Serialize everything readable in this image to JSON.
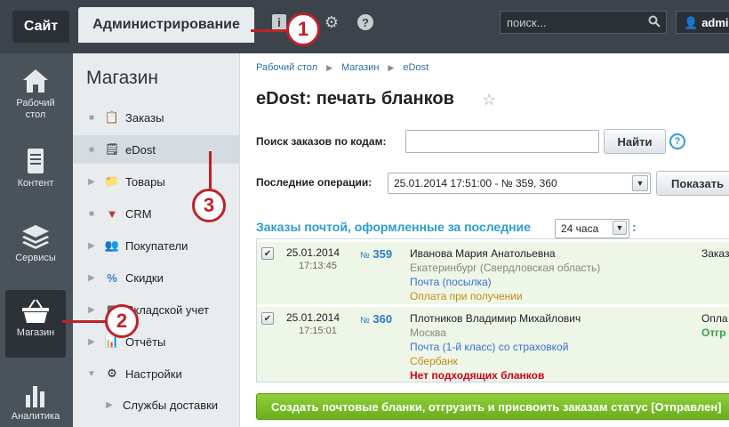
{
  "topbar": {
    "site_tab": "Сайт",
    "admin_tab": "Администрирование",
    "search_placeholder": "поиск...",
    "user": "admin"
  },
  "darkside": {
    "items": [
      {
        "label": "Рабочий стол",
        "icon": "home-icon"
      },
      {
        "label": "Контент",
        "icon": "document-icon"
      },
      {
        "label": "Сервисы",
        "icon": "layers-icon"
      },
      {
        "label": "Магазин",
        "icon": "basket-icon"
      },
      {
        "label": "Аналитика",
        "icon": "bar-chart-icon"
      }
    ]
  },
  "menu": {
    "title": "Магазин",
    "items": [
      {
        "label": "Заказы",
        "icon": "orders-icon",
        "mark": "bullet"
      },
      {
        "label": "eDost",
        "icon": "edost-icon",
        "mark": "bullet"
      },
      {
        "label": "Товары",
        "icon": "folder-icon",
        "mark": "arrow"
      },
      {
        "label": "CRM",
        "icon": "crm-icon",
        "mark": "bullet"
      },
      {
        "label": "Покупатели",
        "icon": "users-icon",
        "mark": "arrow"
      },
      {
        "label": "Скидки",
        "icon": "percent-icon",
        "mark": "arrow"
      },
      {
        "label": "Складской учет",
        "icon": "warehouse-icon",
        "mark": "arrow"
      },
      {
        "label": "Отчёты",
        "icon": "reports-icon",
        "mark": "arrow"
      },
      {
        "label": "Настройки",
        "icon": "settings-icon",
        "mark": "arrow-down"
      }
    ],
    "sub_item": "Службы доставки"
  },
  "breadcrumb": [
    "Рабочий стол",
    "Магазин",
    "eDost"
  ],
  "page_title": "eDost: печать бланков",
  "search": {
    "label": "Поиск заказов по кодам:",
    "value": "",
    "button": "Найти"
  },
  "last_ops": {
    "label": "Последние операции:",
    "selected": "25.01.2014 17:51:00 - № 359, 360",
    "button": "Показать"
  },
  "section": {
    "title": "Заказы почтой, оформленные за последние",
    "period": "24 часа",
    "colon": ":"
  },
  "orders": [
    {
      "date": "25.01.2014",
      "time": "17:13:45",
      "no_sign": "№",
      "number": "359",
      "name": "Иванова Мария Анатольевна",
      "city": "Екатеринбург (Свердловская область)",
      "mail": "Почта (посылка)",
      "payment": "Оплата при получении",
      "status": "",
      "right_top": "Заказ",
      "right_bottom": ""
    },
    {
      "date": "25.01.2014",
      "time": "17:15:01",
      "no_sign": "№",
      "number": "360",
      "name": "Плотников Владимир Михайлович",
      "city": "Москва",
      "mail": "Почта (1-й класс) со страховкой",
      "payment": "Сбербанк",
      "status": "Нет подходящих бланков",
      "right_top": "Опла",
      "right_bottom": "Отгр"
    }
  ],
  "action_button": "Создать почтовые бланки, отгрузить и присвоить заказам статус [Отправлен]",
  "callouts": [
    "1",
    "2",
    "3"
  ],
  "colors": {
    "topbar": "#3c434a",
    "accent_blue": "#2e9cd2",
    "green_button": "#6aae1c",
    "callout_red": "#c0202a"
  }
}
